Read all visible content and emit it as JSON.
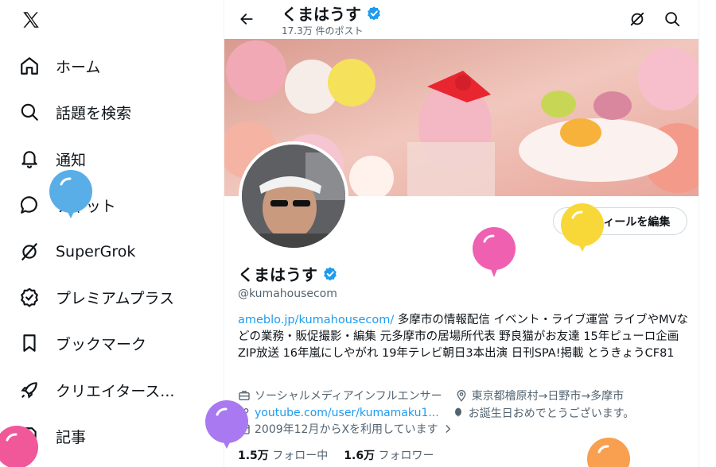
{
  "sidebar": {
    "logo": "x-logo-icon",
    "items": [
      {
        "label": "ホーム",
        "icon": "home-icon"
      },
      {
        "label": "話題を検索",
        "icon": "search-icon"
      },
      {
        "label": "通知",
        "icon": "bell-icon"
      },
      {
        "label": "チャット",
        "icon": "chat-icon"
      },
      {
        "label": "SuperGrok",
        "icon": "grok-icon"
      },
      {
        "label": "プレミアムプラス",
        "icon": "verified-icon"
      },
      {
        "label": "ブックマーク",
        "icon": "bookmark-icon"
      },
      {
        "label": "クリエイタース...",
        "icon": "rocket-icon"
      },
      {
        "label": "記事",
        "icon": "article-icon"
      }
    ]
  },
  "header": {
    "name": "くまはうす",
    "post_count": "17.3万 件のポスト"
  },
  "profile": {
    "edit_label": "プロフィールを編集",
    "name": "くまはうす",
    "handle": "@kumahousecom",
    "bio_link": "ameblo.jp/kumahousecom/",
    "bio_text": " 多摩市の情報配信 イベント・ライブ運営 ライブやMVなどの業務・販促撮影・編集 元多摩市の居場所代表 野良猫がお友達 15年ピューロ企画ZIP放送 16年嵐にしやがれ 19年テレビ朝日3本出演 日刊SPA!掲載 とうきょうCF81",
    "category": "ソーシャルメディアインフルエンサー",
    "location": "東京都檜原村→日野市→多摩市",
    "website": "youtube.com/user/kumamaku1...",
    "birthday": "お誕生日おめでとうございます。",
    "joined": "2009年12月からXを利用しています",
    "following_count": "1.5万",
    "following_label": "フォロー中",
    "followers_count": "1.6万",
    "followers_label": "フォロワー"
  },
  "colors": {
    "accent": "#1d9bf0",
    "muted": "#536471",
    "balloons": [
      "#5aaee8",
      "#f060b0",
      "#f8d838",
      "#a879f0",
      "#f0589a",
      "#f8a050"
    ]
  }
}
